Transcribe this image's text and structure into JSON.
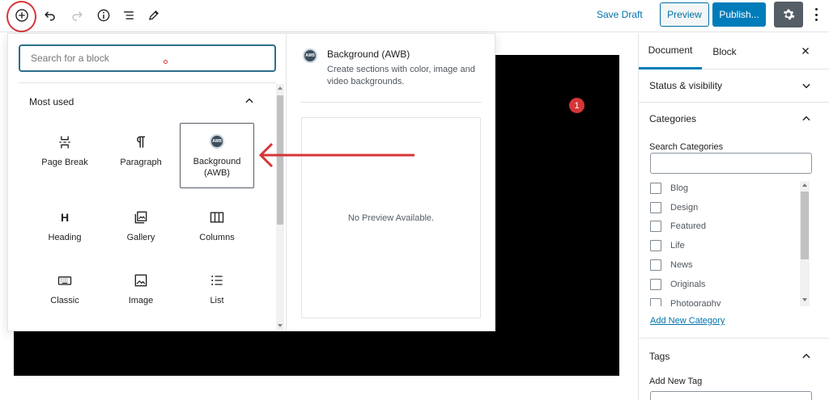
{
  "toolbar": {
    "save_draft": "Save Draft",
    "preview": "Preview",
    "publish": "Publish..."
  },
  "canvas": {
    "badge": "1"
  },
  "inserter": {
    "search_placeholder": "Search for a block",
    "section_title": "Most used",
    "blocks": [
      {
        "label": "Page Break",
        "icon": "page-break-icon"
      },
      {
        "label": "Paragraph",
        "icon": "paragraph-icon"
      },
      {
        "label": "Background (AWB)",
        "icon": "awb-icon"
      },
      {
        "label": "Heading",
        "icon": "heading-icon"
      },
      {
        "label": "Gallery",
        "icon": "gallery-icon"
      },
      {
        "label": "Columns",
        "icon": "columns-icon"
      },
      {
        "label": "Classic",
        "icon": "keyboard-icon"
      },
      {
        "label": "Image",
        "icon": "image-icon"
      },
      {
        "label": "List",
        "icon": "list-icon"
      }
    ],
    "preview": {
      "icon_text": "AWB",
      "title": "Background (AWB)",
      "description": "Create sections with color, image and video backgrounds.",
      "no_preview": "No Preview Available."
    }
  },
  "sidebar": {
    "tabs": [
      "Document",
      "Block"
    ],
    "status_visibility": "Status & visibility",
    "categories": {
      "title": "Categories",
      "search_label": "Search Categories",
      "items": [
        "Blog",
        "Design",
        "Featured",
        "Life",
        "News",
        "Originals",
        "Photography"
      ],
      "add_new": "Add New Category"
    },
    "tags": {
      "title": "Tags",
      "add_new_label": "Add New Tag"
    }
  },
  "colors": {
    "accent": "#007cba",
    "annotation": "#d63638"
  }
}
